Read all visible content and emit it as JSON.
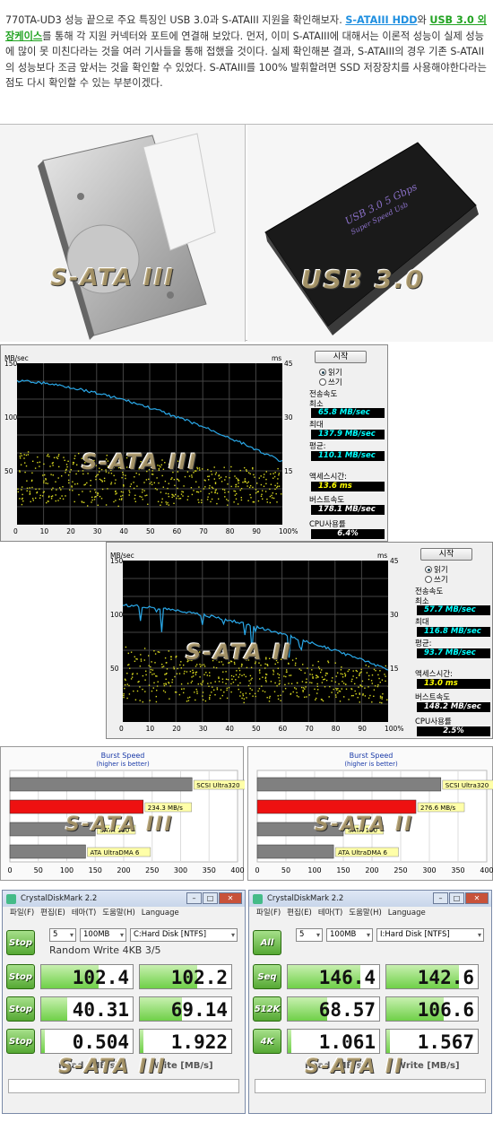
{
  "intro": {
    "text_a": "770TA-UD3 성능 끝으로 주요 특징인 USB 3.0과 S-ATAIII 지원을 확인해보자. ",
    "link1": "S-ATAIII HDD",
    "text_b": "와 ",
    "link2": "USB 3.0 외장케이스",
    "text_c": "를 통해 각 지원 커넥터와 포트에 연결해 보았다. 먼저, 이미 S-ATAIII에 대해서는 이론적 성능이 실제 성능에 많이 못 미친다라는 것을 여러 기사들을 통해 접했을 것이다. 실제 확인해본 결과, S-ATAIII의 경우 기존 S-ATAII의 성능보다 조금 앞서는 것을 확인할 수 있었다. S-ATAIII를 100% 발휘할려면 SSD 저장장치를 사용해야한다라는 점도 다시 확인할 수 있는 부분이겠다."
  },
  "photos": {
    "left_watermark": "S-ATA III",
    "right_watermark": "USB 3.0",
    "enclosure_text1": "USB 3.0  5 Gbps",
    "enclosure_text2": "Super Speed Usb"
  },
  "hdtune1": {
    "watermark": "S-ATA III",
    "left_unit": "MB/sec",
    "right_unit": "ms",
    "y_left": [
      "150",
      "100",
      "50"
    ],
    "y_right": [
      "45",
      "30",
      "15"
    ],
    "x_ticks": [
      "0",
      "10",
      "20",
      "30",
      "40",
      "50",
      "60",
      "70",
      "80",
      "90",
      "100%"
    ],
    "start_button": "시작",
    "read": "읽기",
    "write": "쓰기",
    "transfer_label": "전송속도",
    "min_label": "최소",
    "min_value": "65.8 MB/sec",
    "max_label": "최대",
    "max_value": "137.9 MB/sec",
    "avg_label": "평균:",
    "avg_value": "110.1 MB/sec",
    "access_label": "액세스시간:",
    "access_value": "13.6 ms",
    "burst_label": "버스트속도",
    "burst_value": "178.1 MB/sec",
    "cpu_label": "CPU사용률",
    "cpu_value": "6.4%"
  },
  "hdtune2": {
    "watermark": "S-ATA II",
    "left_unit": "MB/sec",
    "right_unit": "ms",
    "y_left": [
      "150",
      "100",
      "50"
    ],
    "y_right": [
      "45",
      "30",
      "15"
    ],
    "x_ticks": [
      "0",
      "10",
      "20",
      "30",
      "40",
      "50",
      "60",
      "70",
      "80",
      "90",
      "100%"
    ],
    "start_button": "시작",
    "read": "읽기",
    "write": "쓰기",
    "transfer_label": "전송속도",
    "min_label": "최소",
    "min_value": "57.7 MB/sec",
    "max_label": "최대",
    "max_value": "116.8 MB/sec",
    "avg_label": "평균:",
    "avg_value": "93.7 MB/sec",
    "access_label": "액세스시간:",
    "access_value": "13.0 ms",
    "burst_label": "버스트속도",
    "burst_value": "148.2 MB/sec",
    "cpu_label": "CPU사용률",
    "cpu_value": "2.5%"
  },
  "burst_left": {
    "title1": "Burst Speed",
    "title2": "(higher is better)",
    "watermark": "S-ATA III",
    "bars": [
      {
        "label": "SCSI Ultra320",
        "value": 320,
        "color": "#808080"
      },
      {
        "label": "234.3 MB/s",
        "value": 234.3,
        "color": "#ee1111"
      },
      {
        "label": "SATA 150",
        "value": 150,
        "color": "#808080"
      },
      {
        "label": "ATA UltraDMA 6",
        "value": 133,
        "color": "#808080"
      }
    ],
    "x_ticks": [
      "0",
      "50",
      "100",
      "150",
      "200",
      "250",
      "300",
      "350",
      "400"
    ]
  },
  "burst_right": {
    "title1": "Burst Speed",
    "title2": "(higher is better)",
    "watermark": "S-ATA II",
    "bars": [
      {
        "label": "SCSI Ultra320",
        "value": 320,
        "color": "#808080"
      },
      {
        "label": "276.6 MB/s",
        "value": 276.6,
        "color": "#ee1111"
      },
      {
        "label": "SATA 150",
        "value": 150,
        "color": "#808080"
      },
      {
        "label": "ATA UltraDMA 6",
        "value": 133,
        "color": "#808080"
      }
    ],
    "x_ticks": [
      "0",
      "50",
      "100",
      "150",
      "200",
      "250",
      "300",
      "350",
      "400"
    ]
  },
  "cdm_left": {
    "title": "CrystalDiskMark 2.2",
    "menu": [
      "파일(F)",
      "편집(E)",
      "테마(T)",
      "도움말(H)",
      "Language"
    ],
    "top_button": "Stop",
    "count": "5",
    "size": "100MB",
    "drive": "C:Hard Disk [NTFS]",
    "status": "Random Write 4KB 3/5",
    "rows": [
      {
        "btn": "Stop",
        "read": "102.4",
        "write": "102.2",
        "read_fill": 0.62,
        "write_fill": 0.62
      },
      {
        "btn": "Stop",
        "read": "40.31",
        "write": "69.14",
        "read_fill": 0.28,
        "write_fill": 0.45
      },
      {
        "btn": "Stop",
        "read": "0.504",
        "write": "1.922",
        "read_fill": 0.0,
        "write_fill": 0.04
      }
    ],
    "read_header": "Read [MB/s]",
    "write_header": "Write [MB/s]",
    "watermark": "S-ATA III"
  },
  "cdm_right": {
    "title": "CrystalDiskMark 2.2",
    "menu": [
      "파일(F)",
      "편집(E)",
      "테마(T)",
      "도움말(H)",
      "Language"
    ],
    "top_button": "All",
    "count": "5",
    "size": "100MB",
    "drive": "I:Hard Disk [NTFS]",
    "rows": [
      {
        "btn": "Seq",
        "read": "146.4",
        "write": "142.6",
        "read_fill": 0.78,
        "write_fill": 0.78
      },
      {
        "btn": "512K",
        "read": "68.57",
        "write": "106.6",
        "read_fill": 0.42,
        "write_fill": 0.62
      },
      {
        "btn": "4K",
        "read": "1.061",
        "write": "1.567",
        "read_fill": 0.02,
        "write_fill": 0.03
      }
    ],
    "read_header": "Read [MB/s]",
    "write_header": "Write [MB/s]",
    "watermark": "S-ATA II"
  }
}
